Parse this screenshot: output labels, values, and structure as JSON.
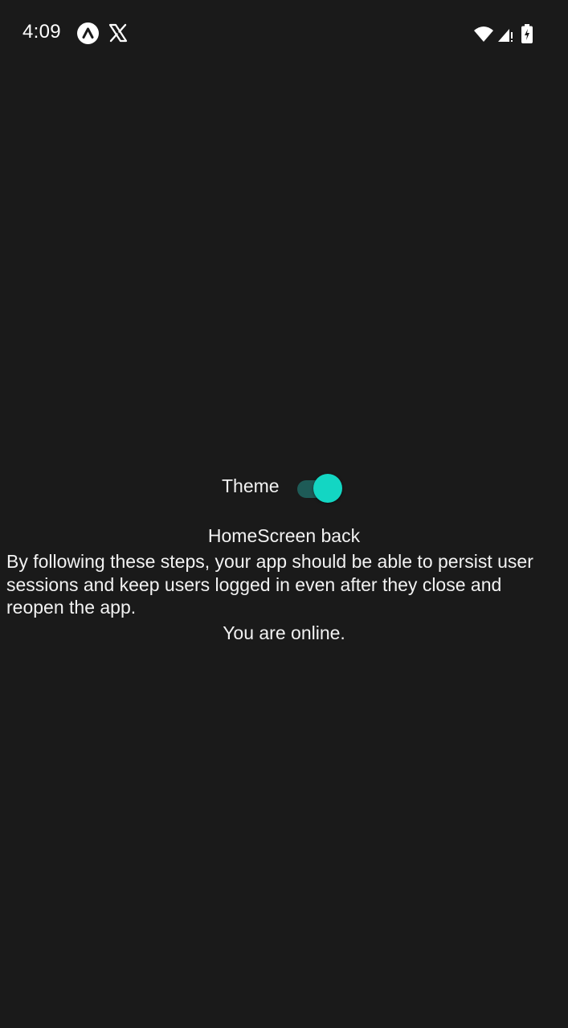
{
  "status_bar": {
    "time": "4:09",
    "notification_icons": [
      "expo-notification-icon",
      "x-notification-icon"
    ],
    "system_icons": [
      "wifi-icon",
      "cellular-signal-icon",
      "battery-charging-icon"
    ]
  },
  "theme_toggle": {
    "label": "Theme",
    "checked": true
  },
  "content": {
    "title": "HomeScreen back",
    "paragraph": "By following these steps, your app should be able to persist user sessions and keep users logged in even after they close and reopen the app.",
    "network_status": "You are online."
  },
  "colors": {
    "background": "#1a1a1a",
    "text": "#f2f2f2",
    "switch_thumb": "#13d6c3",
    "switch_track": "#1e5b57"
  }
}
